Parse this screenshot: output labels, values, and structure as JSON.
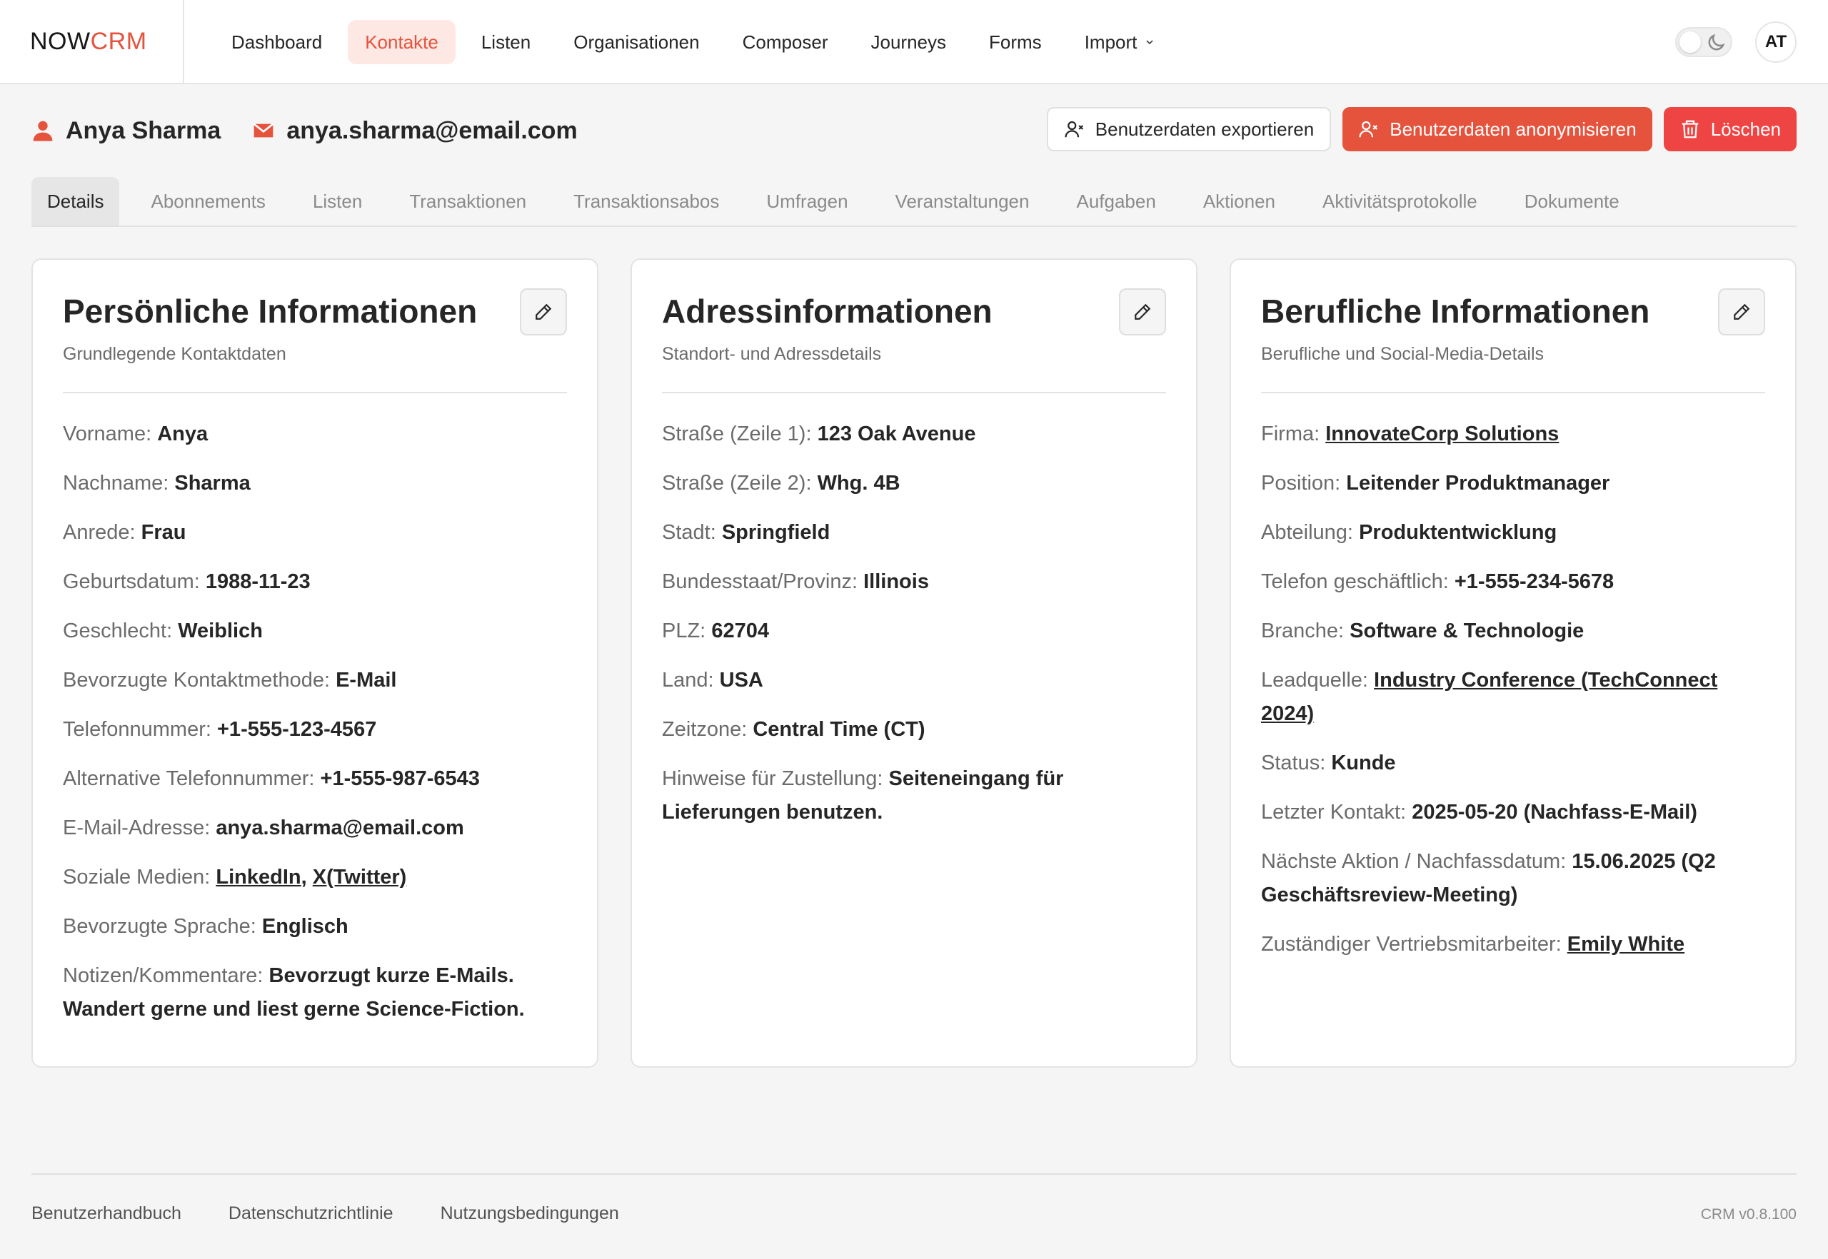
{
  "brand": {
    "part1": "NOW",
    "part2": "CRM"
  },
  "nav": {
    "items": [
      {
        "label": "Dashboard"
      },
      {
        "label": "Kontakte",
        "active": true
      },
      {
        "label": "Listen"
      },
      {
        "label": "Organisationen"
      },
      {
        "label": "Composer"
      },
      {
        "label": "Journeys"
      },
      {
        "label": "Forms"
      },
      {
        "label": "Import",
        "dropdown": true
      }
    ]
  },
  "user": {
    "initials": "AT"
  },
  "theme": {
    "mode": "light"
  },
  "contact": {
    "name": "Anya Sharma",
    "email": "anya.sharma@email.com"
  },
  "actions": {
    "export": "Benutzerdaten exportieren",
    "anonymize": "Benutzerdaten anonymisieren",
    "delete": "Löschen"
  },
  "tabs": [
    {
      "label": "Details",
      "active": true
    },
    {
      "label": "Abonnements"
    },
    {
      "label": "Listen"
    },
    {
      "label": "Transaktionen"
    },
    {
      "label": "Transaktionsabos"
    },
    {
      "label": "Umfragen"
    },
    {
      "label": "Veranstaltungen"
    },
    {
      "label": "Aufgaben"
    },
    {
      "label": "Aktionen"
    },
    {
      "label": "Aktivitätsprotokolle"
    },
    {
      "label": "Dokumente"
    }
  ],
  "cards": {
    "personal": {
      "title": "Persönliche Informationen",
      "subtitle": "Grundlegende Kontaktdaten",
      "fields": [
        {
          "label": "Vorname:",
          "value": "Anya"
        },
        {
          "label": "Nachname:",
          "value": "Sharma"
        },
        {
          "label": "Anrede:",
          "value": "Frau"
        },
        {
          "label": "Geburtsdatum:",
          "value": "1988-11-23"
        },
        {
          "label": "Geschlecht:",
          "value": "Weiblich"
        },
        {
          "label": "Bevorzugte Kontaktmethode:",
          "value": "E-Mail"
        },
        {
          "label": "Telefonnummer:",
          "value": "+1-555-123-4567"
        },
        {
          "label": "Alternative Telefonnummer:",
          "value": "+1-555-987-6543"
        },
        {
          "label": "E-Mail-Adresse:",
          "value": "anya.sharma@email.com"
        },
        {
          "label": "Soziale Medien:",
          "links": [
            "LinkedIn",
            "X(Twitter)"
          ]
        },
        {
          "label": "Bevorzugte Sprache:",
          "value": "Englisch"
        },
        {
          "label": "Notizen/Kommentare:",
          "value": "Bevorzugt kurze E-Mails. Wandert gerne und liest gerne Science-Fiction."
        }
      ]
    },
    "address": {
      "title": "Adressinformationen",
      "subtitle": "Standort- und Adressdetails",
      "fields": [
        {
          "label": "Straße (Zeile 1):",
          "value": "123 Oak Avenue"
        },
        {
          "label": "Straße (Zeile 2):",
          "value": "Whg. 4B"
        },
        {
          "label": "Stadt:",
          "value": "Springfield"
        },
        {
          "label": "Bundesstaat/Provinz:",
          "value": "Illinois"
        },
        {
          "label": "PLZ:",
          "value": "62704"
        },
        {
          "label": "Land:",
          "value": "USA"
        },
        {
          "label": "Zeitzone:",
          "value": "Central Time (CT)"
        },
        {
          "label": "Hinweise für Zustellung:",
          "value": "Seiteneingang für Lieferungen benutzen."
        }
      ]
    },
    "professional": {
      "title": "Berufliche Informationen",
      "subtitle": "Berufliche und Social-Media-Details",
      "fields": [
        {
          "label": "Firma:",
          "value": "InnovateCorp Solutions",
          "link": true
        },
        {
          "label": "Position:",
          "value": "Leitender Produktmanager"
        },
        {
          "label": "Abteilung:",
          "value": "Produktentwicklung"
        },
        {
          "label": "Telefon geschäftlich:",
          "value": "+1-555-234-5678"
        },
        {
          "label": "Branche:",
          "value": "Software & Technologie"
        },
        {
          "label": "Leadquelle:",
          "value": "Industry Conference (TechConnect 2024)",
          "link": true
        },
        {
          "label": "Status:",
          "value": "Kunde"
        },
        {
          "label": "Letzter Kontakt:",
          "value": "2025-05-20 (Nachfass-E-Mail)"
        },
        {
          "label": "Nächste Aktion / Nachfassdatum:",
          "value": "15.06.2025 (Q2 Geschäftsreview-Meeting)"
        },
        {
          "label": "Zuständiger Vertriebsmitarbeiter:",
          "value": "Emily White",
          "link": true
        }
      ]
    }
  },
  "footer": {
    "links": [
      "Benutzerhandbuch",
      "Datenschutzrichtlinie",
      "Nutzungsbedingungen"
    ],
    "version": "CRM v0.8.100"
  },
  "colors": {
    "accent": "#e5533d",
    "danger": "#ef4444",
    "active_nav_bg": "#fde8e3"
  }
}
